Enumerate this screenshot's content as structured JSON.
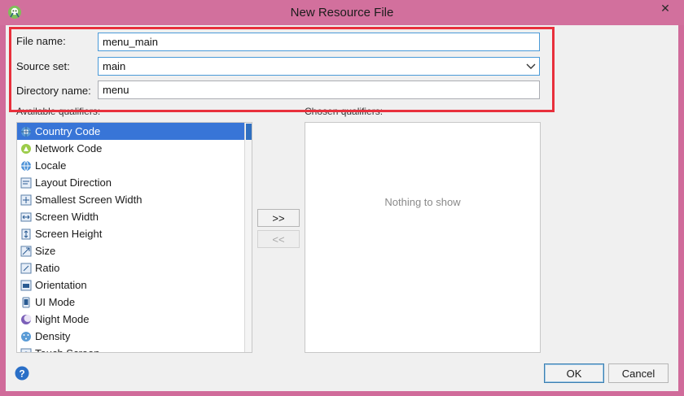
{
  "window": {
    "title": "New Resource File",
    "close_glyph": "✕",
    "app_icon": "android-studio-icon"
  },
  "form": {
    "file_name": {
      "label": "File name:",
      "value": "menu_main"
    },
    "source_set": {
      "label": "Source set:",
      "value": "main"
    },
    "directory_name": {
      "label": "Directory name:",
      "value": "menu"
    }
  },
  "qualifiers": {
    "available_label": "Available qualifiers:",
    "chosen_label": "Chosen qualifiers:",
    "items": [
      {
        "label": "Country Code",
        "icon": "country-code-icon",
        "selected": true
      },
      {
        "label": "Network Code",
        "icon": "network-code-icon"
      },
      {
        "label": "Locale",
        "icon": "globe-icon"
      },
      {
        "label": "Layout Direction",
        "icon": "layout-direction-icon"
      },
      {
        "label": "Smallest Screen Width",
        "icon": "smallest-screen-width-icon"
      },
      {
        "label": "Screen Width",
        "icon": "screen-width-icon"
      },
      {
        "label": "Screen Height",
        "icon": "screen-height-icon"
      },
      {
        "label": "Size",
        "icon": "size-icon"
      },
      {
        "label": "Ratio",
        "icon": "ratio-icon"
      },
      {
        "label": "Orientation",
        "icon": "orientation-icon"
      },
      {
        "label": "UI Mode",
        "icon": "ui-mode-icon"
      },
      {
        "label": "Night Mode",
        "icon": "night-mode-icon"
      },
      {
        "label": "Density",
        "icon": "density-icon"
      },
      {
        "label": "Touch Screen",
        "icon": "touch-screen-icon"
      }
    ],
    "empty_text": "Nothing to show",
    "add_label": ">>",
    "remove_label": "<<"
  },
  "buttons": {
    "ok": "OK",
    "cancel": "Cancel"
  },
  "colors": {
    "title_bar": "#d2709d",
    "selection": "#3875d7",
    "highlight": "#e8303c",
    "focus": "#4a9ad8"
  }
}
